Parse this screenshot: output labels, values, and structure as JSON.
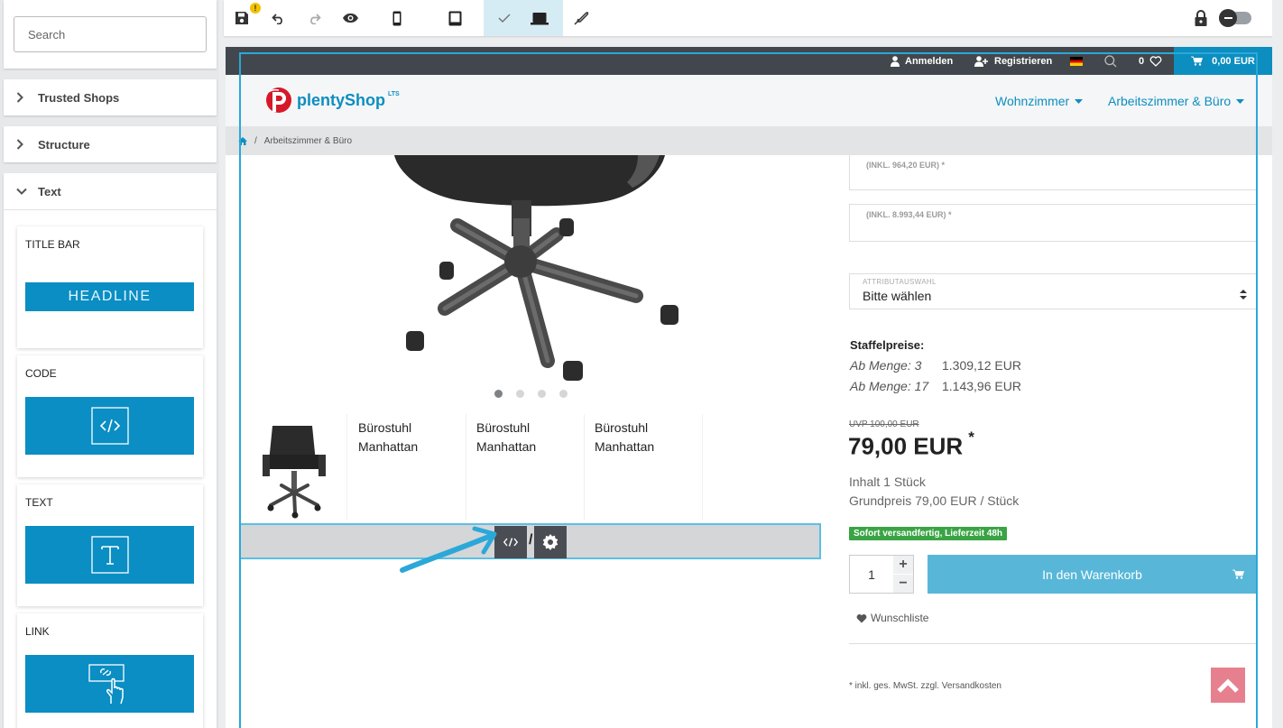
{
  "sidebar": {
    "search_placeholder": "Search",
    "sections": {
      "trusted_shops": "Trusted Shops",
      "structure": "Structure",
      "text": "Text"
    },
    "widgets": [
      {
        "title": "TITLE BAR",
        "preview": "HEADLINE",
        "icon": "headline-preview"
      },
      {
        "title": "CODE",
        "icon": "code-icon"
      },
      {
        "title": "TEXT",
        "icon": "text-icon"
      },
      {
        "title": "LINK",
        "icon": "link-icon"
      }
    ]
  },
  "toolbar": {
    "icons": [
      "save-icon",
      "warning-badge",
      "undo-icon",
      "redo-icon",
      "preview-eye-icon",
      "mobile-icon",
      "tablet-icon",
      "check-icon",
      "desktop-icon",
      "feather-icon",
      "lock-icon",
      "toggle-switch"
    ],
    "warning_badge": "!"
  },
  "shop": {
    "topbar": {
      "login": "Anmelden",
      "register": "Registrieren",
      "wishlist_count": "0",
      "cart_total": "0,00 EUR"
    },
    "logo": {
      "text": "plentyShop",
      "suffix": "LTS"
    },
    "nav": [
      "Wohnzimmer",
      "Arbeitszimmer & Büro"
    ],
    "breadcrumb": {
      "separator": "/",
      "current": "Arbeitszimmer & Büro"
    },
    "thumbnails": [
      "Bürostuhl Manhattan",
      "Bürostuhl Manhattan",
      "Bürostuhl Manhattan"
    ],
    "variation_prices": [
      "(INKL. 964,20 EUR) *",
      "(INKL. 8.993,44 EUR) *"
    ],
    "attribute": {
      "label": "ATTRIBUTAUSWAHL",
      "value": "Bitte wählen"
    },
    "staffel": {
      "title": "Staffelpreise:",
      "rows": [
        {
          "qty": "Ab Menge: 3",
          "price": "1.309,12 EUR"
        },
        {
          "qty": "Ab Menge: 17",
          "price": "1.143,96 EUR"
        }
      ]
    },
    "uvp": "UVP 100,00 EUR",
    "price": "79,00 EUR",
    "price_star": "*",
    "content": "Inhalt 1 Stück",
    "base_price": "Grundpreis 79,00 EUR / Stück",
    "availability": "Sofort versandfertig, Lieferzeit 48h",
    "quantity": "1",
    "qty_plus": "+",
    "qty_minus": "−",
    "add_to_cart": "In den Warenkorb",
    "wishlist": "Wunschliste",
    "footnote": "* inkl. ges. MwSt. zzgl. Versandkosten",
    "codebar_separator": "/"
  },
  "colors": {
    "accent": "#0c8ec0",
    "widget_blue": "#0a8ec3",
    "topbar": "#42474d",
    "availability": "#3aa444",
    "totop": "#e7808e",
    "arrow": "#2ba8d8"
  }
}
